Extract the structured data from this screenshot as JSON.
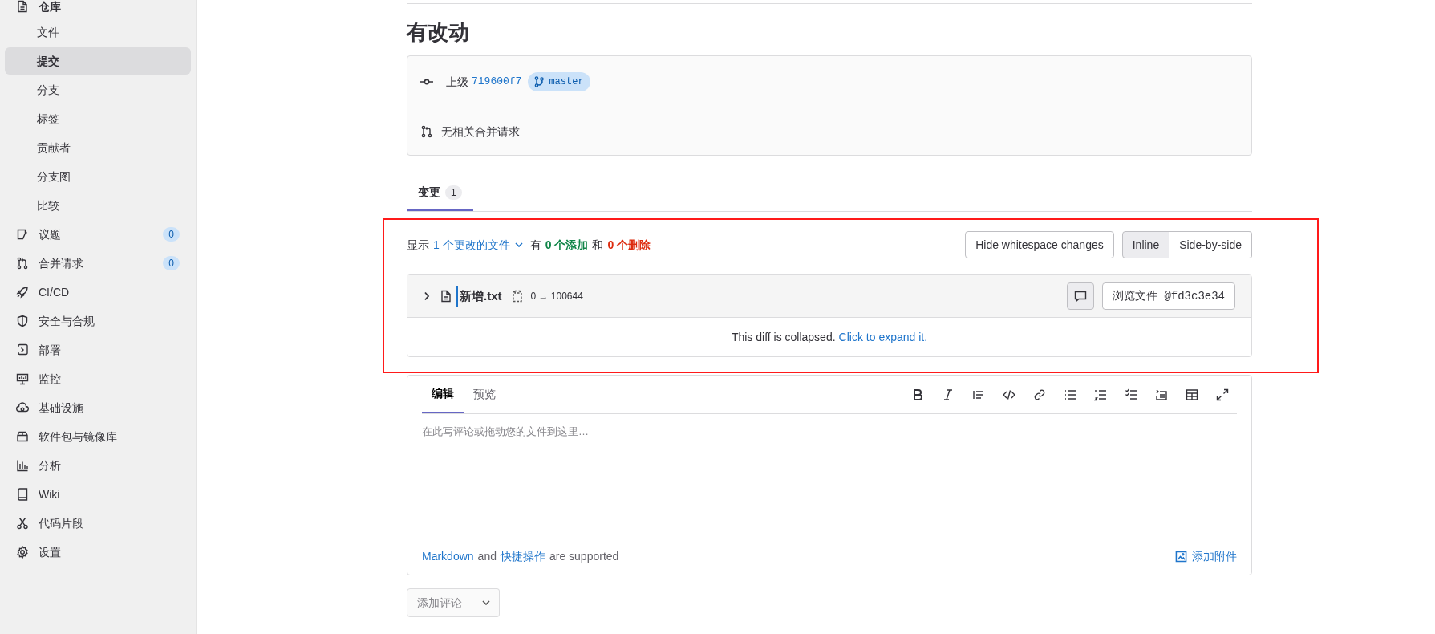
{
  "sidebar": {
    "section": {
      "label": "仓库",
      "children": [
        {
          "label": "文件",
          "selected": false
        },
        {
          "label": "提交",
          "selected": true
        },
        {
          "label": "分支",
          "selected": false
        },
        {
          "label": "标签",
          "selected": false
        },
        {
          "label": "贡献者",
          "selected": false
        },
        {
          "label": "分支图",
          "selected": false
        },
        {
          "label": "比较",
          "selected": false
        }
      ]
    },
    "items": [
      {
        "label": "议题",
        "badge": "0"
      },
      {
        "label": "合并请求",
        "badge": "0"
      },
      {
        "label": "CI/CD"
      },
      {
        "label": "安全与合规"
      },
      {
        "label": "部署"
      },
      {
        "label": "监控"
      },
      {
        "label": "基础设施"
      },
      {
        "label": "软件包与镜像库"
      },
      {
        "label": "分析"
      },
      {
        "label": "Wiki"
      },
      {
        "label": "代码片段"
      },
      {
        "label": "设置"
      }
    ]
  },
  "commit": {
    "title": "有改动",
    "parent_label": "上级",
    "parent_sha": "719600f7",
    "branch": "master",
    "merge_requests": "无相关合并请求"
  },
  "tabs": [
    {
      "label": "变更",
      "count": "1",
      "selected": true
    }
  ],
  "diff_summary": {
    "prefix": "显示",
    "files_link": "1 个更改的文件",
    "has": "有",
    "additions": "0 个添加",
    "and": "和",
    "deletions": "0 个删除"
  },
  "diff_buttons": {
    "whitespace": "Hide whitespace changes",
    "views": [
      {
        "label": "Inline",
        "selected": true
      },
      {
        "label": "Side-by-side",
        "selected": false
      }
    ]
  },
  "file": {
    "name": "新增.txt",
    "mode": "0 → 100644",
    "view_button": "浏览文件 @fd3c3e34",
    "collapsed_text": "This diff is collapsed.",
    "expand_link": "Click to expand it."
  },
  "editor": {
    "tabs": [
      {
        "label": "编辑",
        "selected": true
      },
      {
        "label": "预览",
        "selected": false
      }
    ],
    "placeholder": "在此写评论或拖动您的文件到这里…",
    "footer_link1": "Markdown",
    "footer_and": "and",
    "footer_link2": "快捷操作",
    "footer_rest": "are supported",
    "attach": "添加附件"
  },
  "submit": {
    "label": "添加评论"
  }
}
